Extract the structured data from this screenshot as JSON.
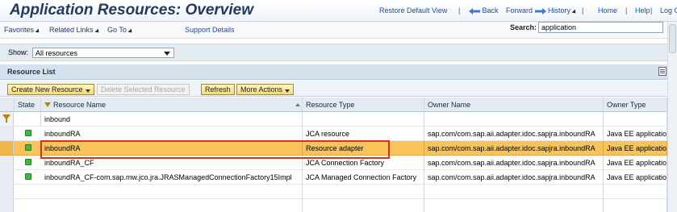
{
  "header": {
    "title": "Application Resources: Overview",
    "links": {
      "restore_default": "Restore Default View",
      "sep1": "|",
      "back": "Back",
      "forward": "Forward",
      "history": "History",
      "sep2": "|",
      "home": "Home",
      "sep3": "|",
      "help": "Help",
      "sep4": "|",
      "logoff": "Log Off"
    }
  },
  "menubar": {
    "favorites": "Favorites",
    "related_links": "Related Links",
    "go_to": "Go To",
    "support_details": "Support Details",
    "search_label": "Search:",
    "search_value": "application"
  },
  "showbar": {
    "label": "Show:",
    "selected": "All resources"
  },
  "panel": {
    "title": "Resource List"
  },
  "toolbar": {
    "create": "Create New Resource",
    "delete": "Delete Selected Resource",
    "refresh": "Refresh",
    "more_actions": "More Actions"
  },
  "table": {
    "columns": [
      "State",
      "Resource Name",
      "Resource Type",
      "Owner Name",
      "Owner Type"
    ],
    "filter_value": "inbound",
    "rows": [
      {
        "name": "inboundRA",
        "type": "JCA resource",
        "owner": "sap.com/com.sap.aii.adapter.idoc.sapjra.inboundRA",
        "owner_type": "Java EE application"
      },
      {
        "name": "inboundRA",
        "type": "Resource adapter",
        "owner": "sap.com/com.sap.aii.adapter.idoc.sapjra.inboundRA",
        "owner_type": "Java EE application"
      },
      {
        "name": "inboundRA_CF",
        "type": "JCA Connection Factory",
        "owner": "sap.com/com.sap.aii.adapter.idoc.sapjra.inboundRA",
        "owner_type": "Java EE application"
      },
      {
        "name": "inboundRA_CF-com.sap.mw.jco.jra.JRASManagedConnectionFactory15Impl",
        "type": "JCA Managed Connection Factory",
        "owner": "sap.com/com.sap.aii.adapter.idoc.sapjra.inboundRA",
        "owner_type": "Java EE application"
      }
    ],
    "highlighted_row": 1
  },
  "colors": {
    "title": "#223a5e",
    "link": "#1a4fa0",
    "highlight_row": "#f8c35a",
    "status_ok": "#3fb93a",
    "callout": "#d0312d"
  }
}
